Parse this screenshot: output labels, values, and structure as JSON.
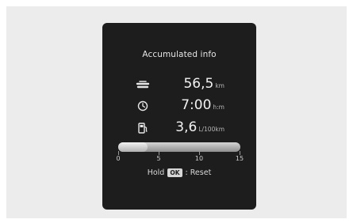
{
  "screen": {
    "title": "Accumulated info",
    "rows": [
      {
        "icon": "distance-icon",
        "value": "56,5",
        "unit": "km"
      },
      {
        "icon": "clock-icon",
        "value": "7:00",
        "unit": "h:m"
      },
      {
        "icon": "fuel-pump-icon",
        "value": "3,6",
        "unit": "L/100km"
      }
    ],
    "gauge": {
      "min": 0,
      "max": 15,
      "value": 3.6,
      "scale_labels": [
        "0",
        "5",
        "10",
        "15"
      ]
    },
    "hint": {
      "hold": "Hold",
      "key": "OK",
      "action": ": Reset"
    }
  },
  "colors": {
    "screen_bg": "#1d1d1d",
    "frame_bg": "#ececec",
    "text": "#eaeaea"
  }
}
